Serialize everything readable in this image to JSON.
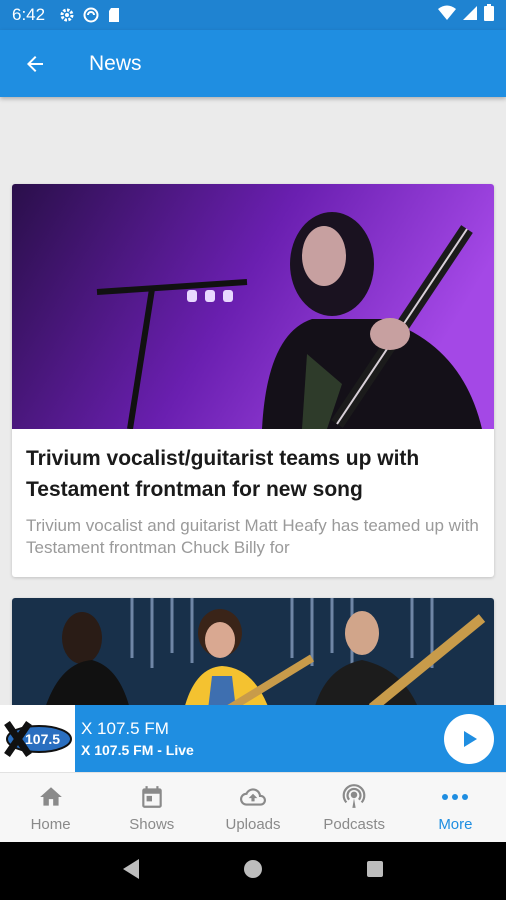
{
  "status_bar": {
    "time": "6:42",
    "left_icons": [
      "gear-icon",
      "sync-icon",
      "sd-card-icon"
    ],
    "right_icons": [
      "wifi-icon",
      "signal-icon",
      "battery-icon"
    ]
  },
  "header": {
    "title": "News",
    "back_icon": "arrow-left-icon",
    "color": "#1f8ee1"
  },
  "news": [
    {
      "title": "Trivium vocalist/guitarist teams up with Testament frontman for new song",
      "summary": "Trivium vocalist and guitarist Matt Heafy has teamed up with Testament frontman Chuck Billy for",
      "image": "concert-photo-guitarist"
    },
    {
      "title": "",
      "summary": "",
      "image": "band-photo"
    }
  ],
  "player": {
    "logo_text": "107.5",
    "station": "X 107.5 FM",
    "status": "X 107.5 FM - Live",
    "play_icon": "play-icon"
  },
  "bottom_nav": {
    "items": [
      {
        "label": "Home",
        "icon": "home-icon"
      },
      {
        "label": "Shows",
        "icon": "calendar-icon"
      },
      {
        "label": "Uploads",
        "icon": "cloud-upload-icon"
      },
      {
        "label": "Podcasts",
        "icon": "podcast-icon"
      },
      {
        "label": "More",
        "icon": "more-dots-icon"
      }
    ],
    "active": "More"
  },
  "system_nav": [
    "back-triangle-icon",
    "home-circle-icon",
    "recents-square-icon"
  ]
}
